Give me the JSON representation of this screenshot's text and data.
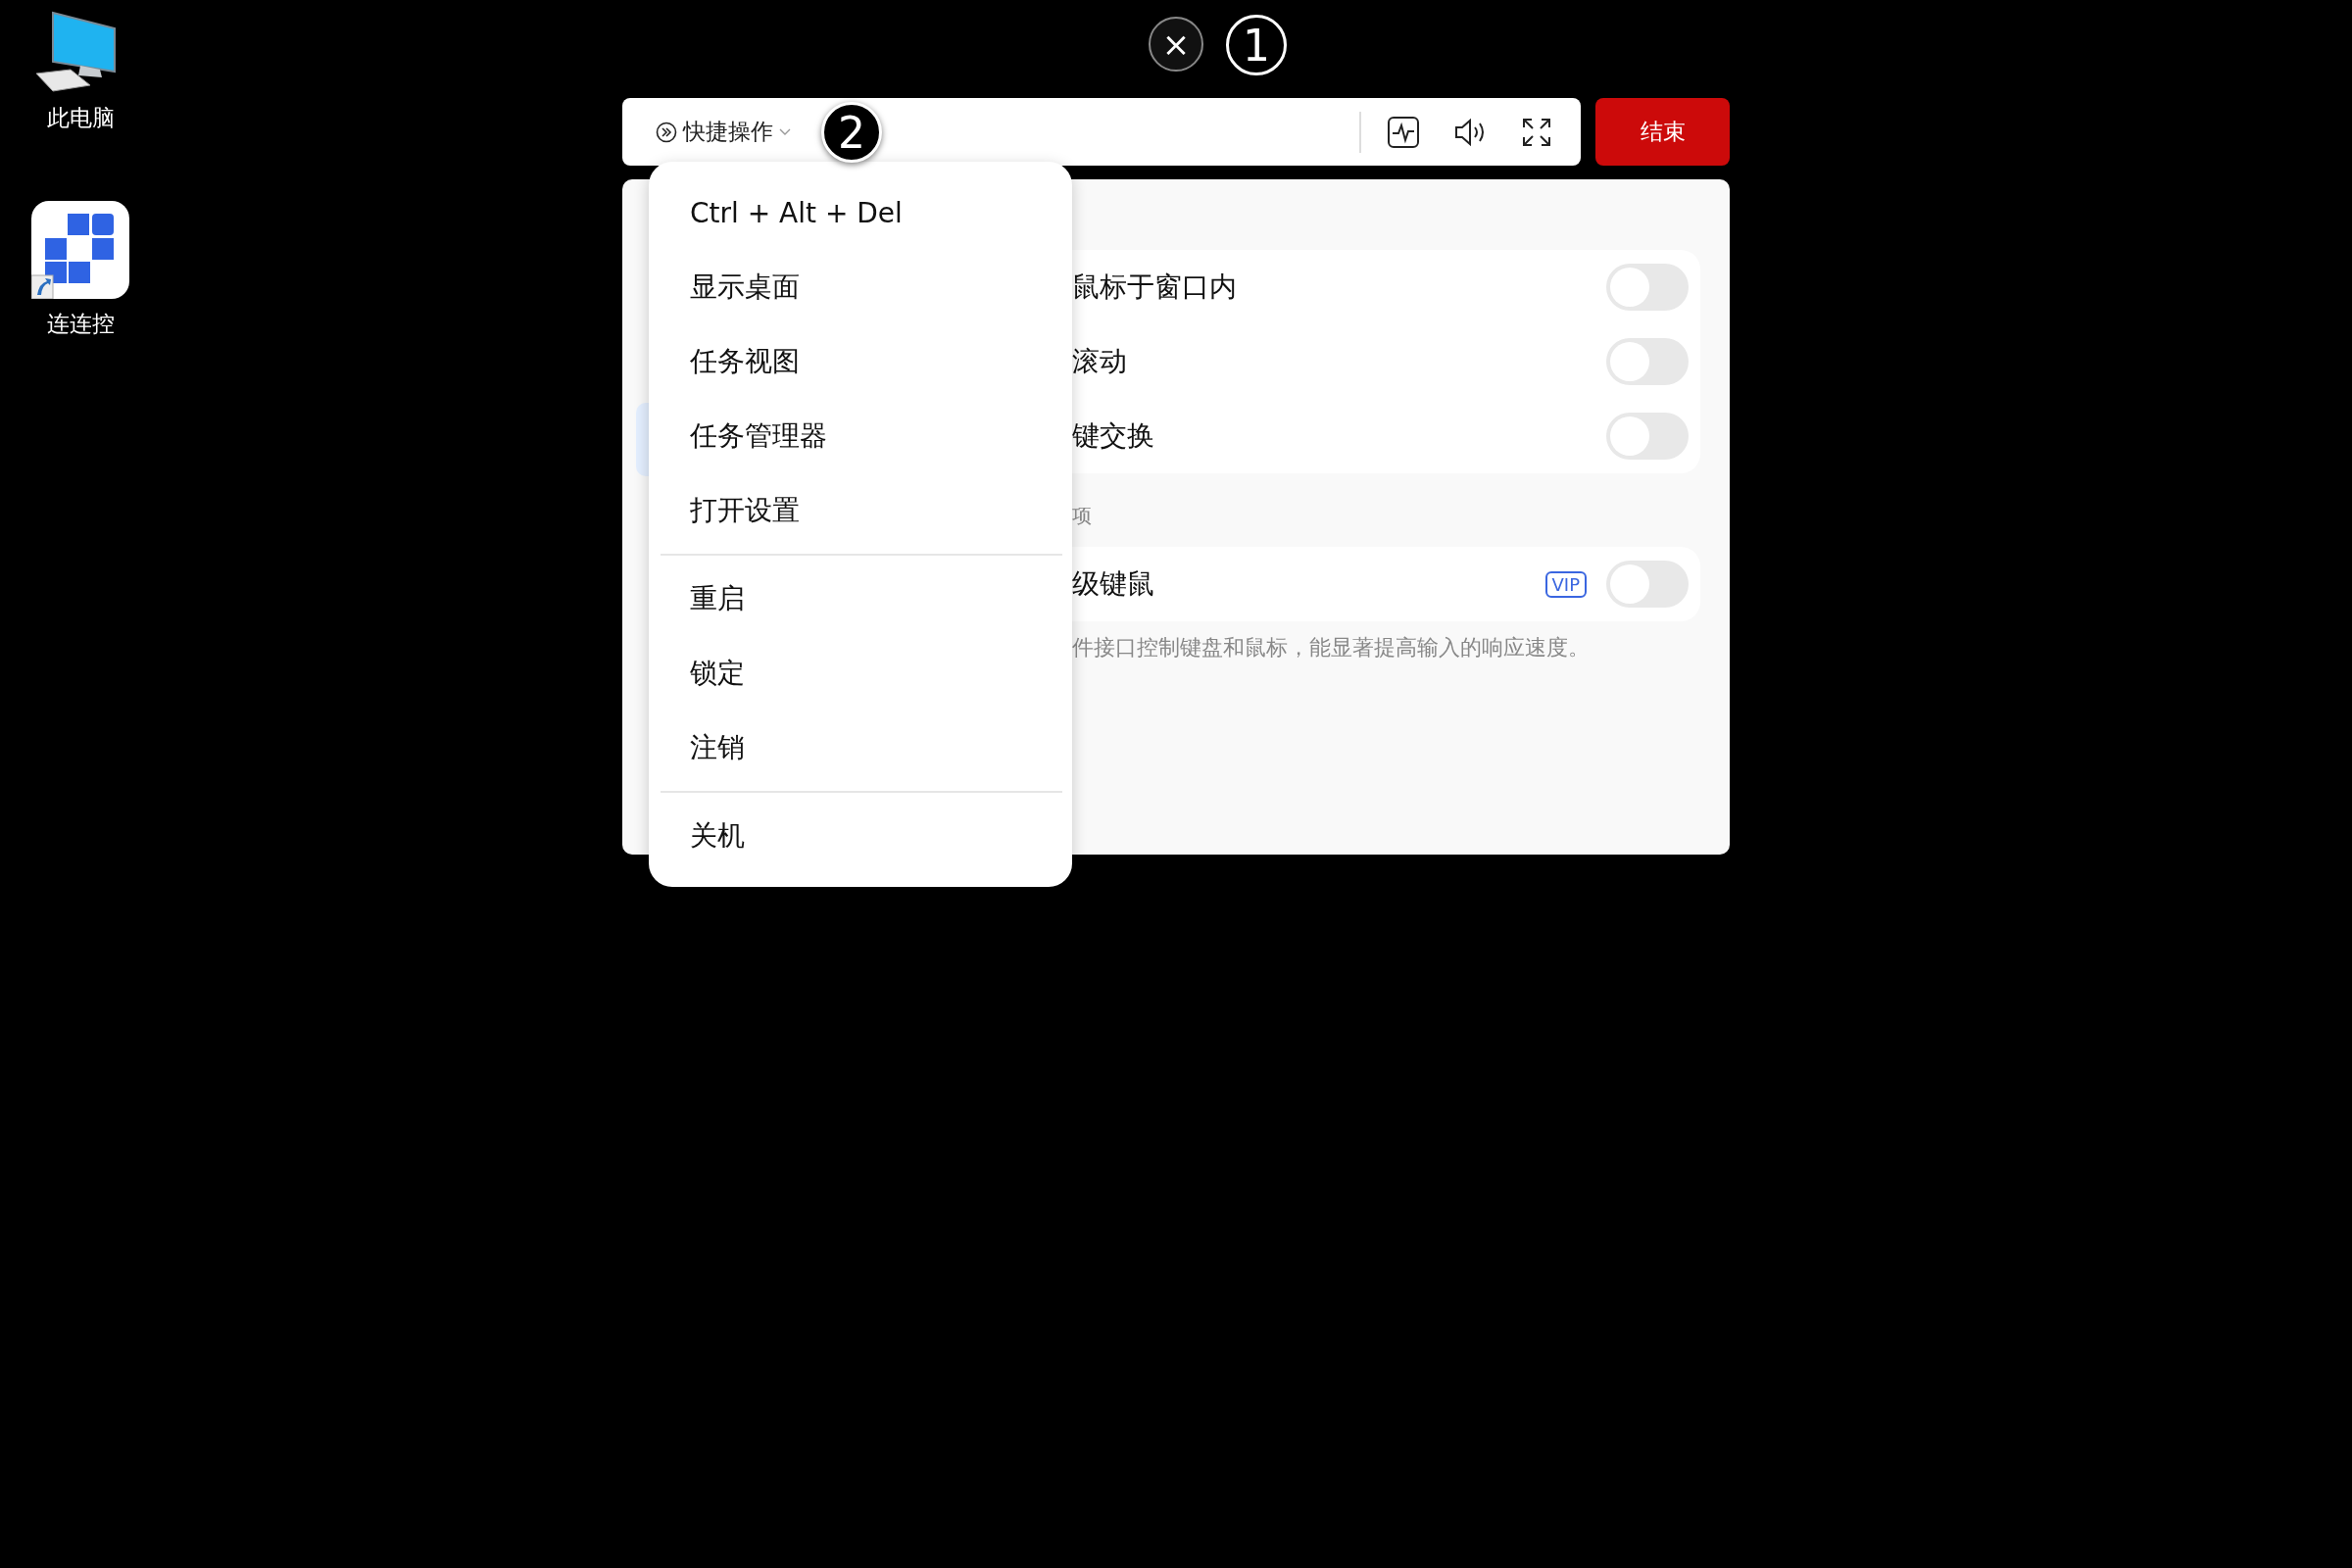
{
  "desktop_icons": [
    {
      "kind": "computer",
      "label": "此电脑"
    },
    {
      "kind": "app",
      "label": "连连控"
    }
  ],
  "close_button": {
    "label": "×"
  },
  "callouts": [
    {
      "label": "1"
    },
    {
      "label": "2"
    }
  ],
  "toolbar": {
    "quick_actions": "快捷操作",
    "end_button": "结束"
  },
  "menu": {
    "groups": [
      [
        "Ctrl + Alt + Del",
        "显示桌面",
        "任务视图",
        "任务管理器",
        "打开设置"
      ],
      [
        "重启",
        "锁定",
        "注销"
      ],
      [
        "关机"
      ]
    ]
  },
  "settings": {
    "card_1": [
      {
        "label": "鼠标于窗口内",
        "on": false
      },
      {
        "label": "滚动",
        "on": false
      },
      {
        "label": "键交换",
        "on": false
      }
    ],
    "section_label": "项",
    "card_2": [
      {
        "label": "级键鼠",
        "badge": "VIP",
        "on": false
      }
    ],
    "description": "件接口控制键盘和鼠标，能显著提高输入的响应速度。"
  }
}
